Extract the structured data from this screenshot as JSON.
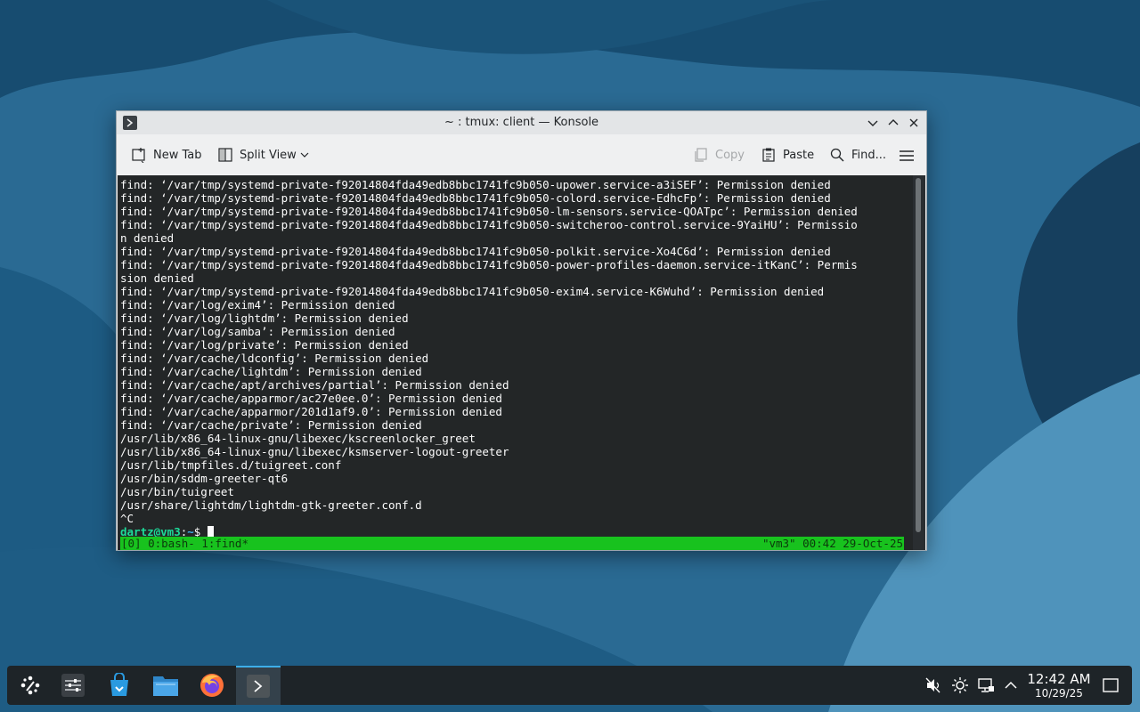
{
  "window": {
    "title": "~ : tmux: client — Konsole"
  },
  "toolbar": {
    "new_tab_label": "New Tab",
    "split_view_label": "Split View",
    "copy_label": "Copy",
    "paste_label": "Paste",
    "find_label": "Find..."
  },
  "terminal": {
    "output": "find: ‘/var/tmp/systemd-private-f92014804fda49edb8bbc1741fc9b050-upower.service-a3iSEF’: Permission denied\nfind: ‘/var/tmp/systemd-private-f92014804fda49edb8bbc1741fc9b050-colord.service-EdhcFp’: Permission denied\nfind: ‘/var/tmp/systemd-private-f92014804fda49edb8bbc1741fc9b050-lm-sensors.service-QOATpc’: Permission denied\nfind: ‘/var/tmp/systemd-private-f92014804fda49edb8bbc1741fc9b050-switcheroo-control.service-9YaiHU’: Permissio\nn denied\nfind: ‘/var/tmp/systemd-private-f92014804fda49edb8bbc1741fc9b050-polkit.service-Xo4C6d’: Permission denied\nfind: ‘/var/tmp/systemd-private-f92014804fda49edb8bbc1741fc9b050-power-profiles-daemon.service-itKanC’: Permis\nsion denied\nfind: ‘/var/tmp/systemd-private-f92014804fda49edb8bbc1741fc9b050-exim4.service-K6Wuhd’: Permission denied\nfind: ‘/var/log/exim4’: Permission denied\nfind: ‘/var/log/lightdm’: Permission denied\nfind: ‘/var/log/samba’: Permission denied\nfind: ‘/var/log/private’: Permission denied\nfind: ‘/var/cache/ldconfig’: Permission denied\nfind: ‘/var/cache/lightdm’: Permission denied\nfind: ‘/var/cache/apt/archives/partial’: Permission denied\nfind: ‘/var/cache/apparmor/ac27e0ee.0’: Permission denied\nfind: ‘/var/cache/apparmor/201d1af9.0’: Permission denied\nfind: ‘/var/cache/private’: Permission denied\n/usr/lib/x86_64-linux-gnu/libexec/kscreenlocker_greet\n/usr/lib/x86_64-linux-gnu/libexec/ksmserver-logout-greeter\n/usr/lib/tmpfiles.d/tuigreet.conf\n/usr/bin/sddm-greeter-qt6\n/usr/bin/tuigreet\n/usr/share/lightdm/lightdm-gtk-greeter.conf.d\n^C",
    "prompt_user": "dartz@vm3",
    "prompt_sep": ":",
    "prompt_path": "~",
    "prompt_symbol": "$ "
  },
  "tmux": {
    "status_left": "[0] 0:bash- 1:find*",
    "status_right": "\"vm3\" 00:42 29-Oct-25",
    "bar_color": "#18c21e"
  },
  "taskbar": {
    "apps": [
      {
        "name": "application-launcher",
        "icon": "kde-launcher-icon"
      },
      {
        "name": "system-settings",
        "icon": "settings-sliders-icon"
      },
      {
        "name": "discover",
        "icon": "store-bag-icon"
      },
      {
        "name": "dolphin",
        "icon": "folder-icon"
      },
      {
        "name": "firefox",
        "icon": "firefox-icon"
      },
      {
        "name": "konsole",
        "icon": "terminal-icon",
        "active": true
      }
    ],
    "tray": [
      "volume-muted-icon",
      "brightness-icon",
      "network-icon",
      "chevron-up-icon"
    ],
    "clock_time": "12:42 AM",
    "clock_date": "10/29/25"
  },
  "colors": {
    "accent": "#3daee9",
    "terminal_bg": "#232627",
    "desktop_bg": "#1f5a82"
  }
}
